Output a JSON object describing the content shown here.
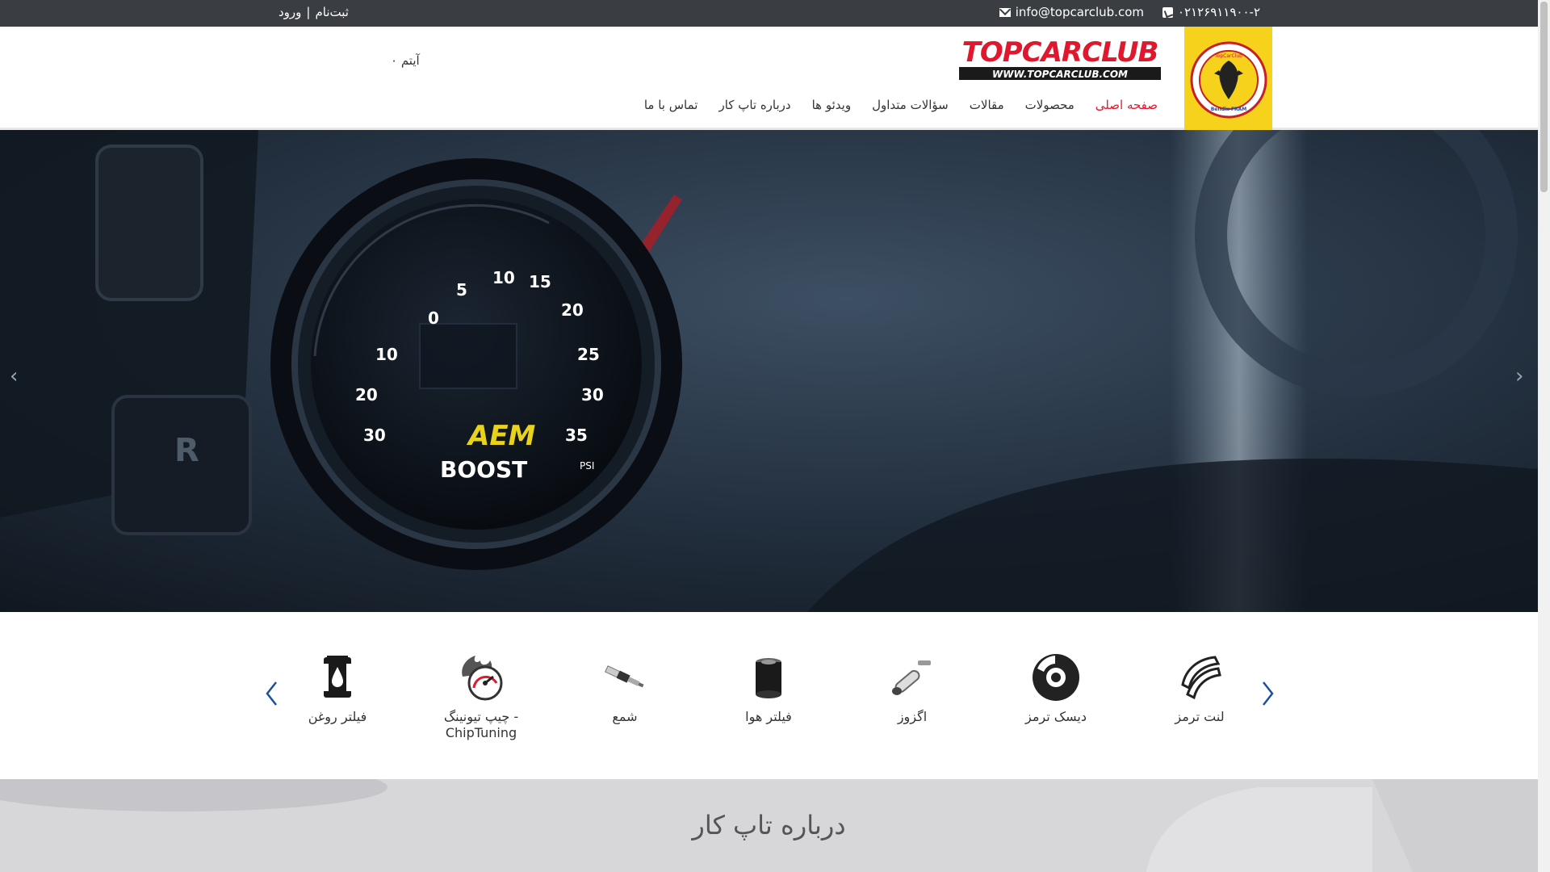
{
  "topbar": {
    "phone": "۰۲۱۲۶۹۱۱۹۰۰-۲",
    "email": "info@topcarclub.com",
    "login": "ورود",
    "separator": "|",
    "register": "ثبت‌نام"
  },
  "header": {
    "logo_title": "TOPCARCLUB",
    "logo_url": "WWW.TOPCARCLUB.COM",
    "badge_label": "TopCarClub",
    "badge_text": "Bendix FRAM",
    "cart": "۰ آیتم"
  },
  "nav": {
    "items": [
      {
        "label": "صفحه اصلی",
        "active": true
      },
      {
        "label": "محصولات",
        "active": false
      },
      {
        "label": "مقالات",
        "active": false
      },
      {
        "label": "سؤالات متداول",
        "active": false
      },
      {
        "label": "ویدئو ها",
        "active": false
      },
      {
        "label": "درباره تاپ کار",
        "active": false
      },
      {
        "label": "تماس با ما",
        "active": false
      }
    ]
  },
  "hero": {
    "gauge_brand": "AEM",
    "gauge_label": "BOOST",
    "gauge_unit": "PSI",
    "gear_label": "R",
    "gauge_ticks": [
      "30",
      "20",
      "10",
      "0",
      "5",
      "10",
      "15",
      "20",
      "25",
      "30",
      "35"
    ]
  },
  "products": {
    "items": [
      {
        "label": "لنت ترمز",
        "icon": "brake-pad-icon"
      },
      {
        "label": "دیسک ترمز",
        "icon": "brake-disc-icon"
      },
      {
        "label": "اگزوز",
        "icon": "exhaust-icon"
      },
      {
        "label": "فیلتر هوا",
        "icon": "air-filter-icon"
      },
      {
        "label": "شمع",
        "icon": "spark-plug-icon"
      },
      {
        "label": "چیپ تیونینگ - ChipTuning",
        "icon": "chip-tuning-icon"
      },
      {
        "label": "فیلتر روغن",
        "icon": "oil-filter-icon"
      }
    ]
  },
  "about": {
    "title": "درباره تاپ کار"
  },
  "colors": {
    "topbar_bg": "#3a3d41",
    "active_nav": "#e1182d",
    "badge_yellow": "#f6d21c"
  }
}
